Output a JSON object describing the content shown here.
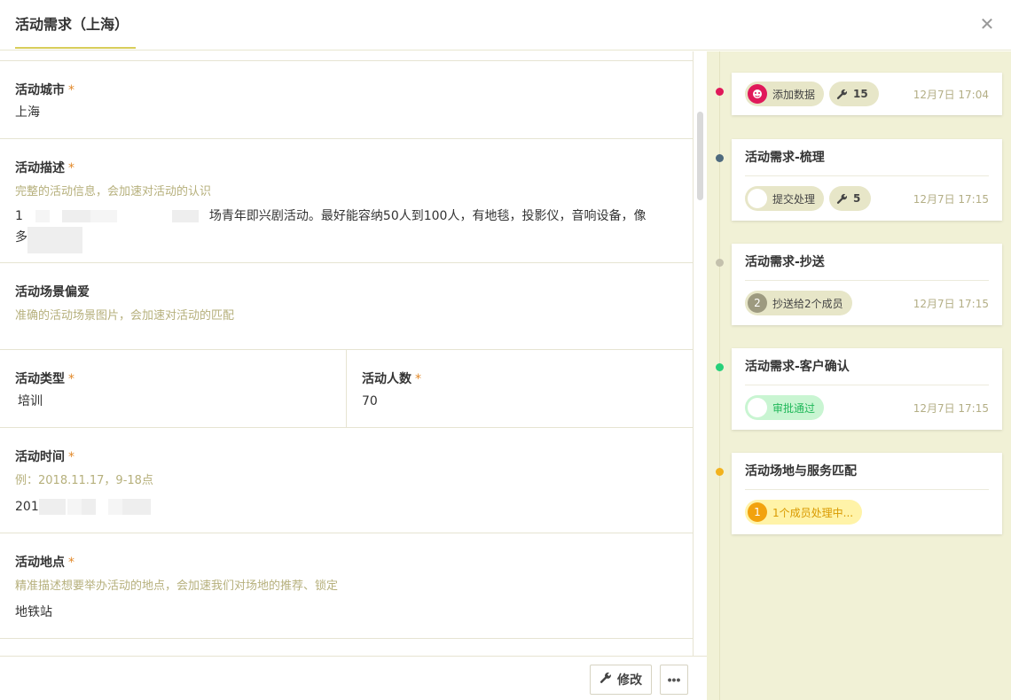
{
  "header": {
    "title": "活动需求（上海）",
    "close": "✕"
  },
  "form": {
    "city": {
      "label": "活动城市",
      "value": "上海"
    },
    "description": {
      "label": "活动描述",
      "hint": "完整的活动信息，会加速对活动的认识",
      "value_prefix": "1",
      "value_text": "场青年即兴剧活动。最好能容纳50人到100人，有地毯，投影仪，音响设备，像",
      "value_line2": "多"
    },
    "scene": {
      "label": "活动场景偏爱",
      "hint": "准确的活动场景图片，会加速对活动的匹配"
    },
    "type": {
      "label": "活动类型",
      "value": "培训"
    },
    "people": {
      "label": "活动人数",
      "value": "70"
    },
    "time": {
      "label": "活动时间",
      "hint": "例：2018.11.17，9-18点",
      "value_prefix": "201"
    },
    "location": {
      "label": "活动地点",
      "hint": "精准描述想要举办活动的地点，会加速我们对场地的推荐、锁定",
      "value": "地铁站"
    }
  },
  "footer": {
    "edit_label": "修改",
    "more_label": "•••"
  },
  "timeline": [
    {
      "dot_color": "#e0195a",
      "pill_label": "添加数据",
      "tool_count": "15",
      "time": "12月7日 17:04"
    },
    {
      "dot_color": "#4e6a7e",
      "title": "活动需求-梳理",
      "pill_label": "提交处理",
      "tool_count": "5",
      "time": "12月7日 17:15"
    },
    {
      "dot_color": "#c4c1ad",
      "title": "活动需求-抄送",
      "badge": "2",
      "pill_label": "抄送给2个成员",
      "time": "12月7日 17:15"
    },
    {
      "dot_color": "#27d07a",
      "title": "活动需求-客户确认",
      "pill_label": "审批通过",
      "time": "12月7日 17:15"
    },
    {
      "dot_color": "#f2b21e",
      "title": "活动场地与服务匹配",
      "badge": "1",
      "pill_label": "1个成员处理中..."
    }
  ]
}
